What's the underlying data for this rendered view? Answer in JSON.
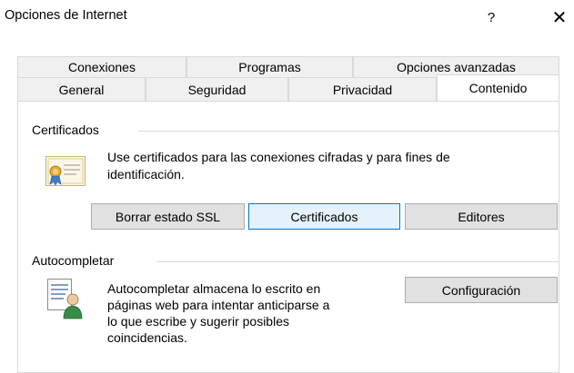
{
  "window": {
    "title": "Opciones de Internet",
    "help_glyph": "?",
    "close_glyph": "✕"
  },
  "tabs": {
    "back_row": [
      {
        "label": "Conexiones"
      },
      {
        "label": "Programas"
      },
      {
        "label": "Opciones avanzadas"
      }
    ],
    "front_row": [
      {
        "label": "General"
      },
      {
        "label": "Seguridad"
      },
      {
        "label": "Privacidad"
      },
      {
        "label": "Contenido",
        "active": true
      }
    ]
  },
  "certificates": {
    "group_label": "Certificados",
    "description_line1": "Use certificados para las conexiones cifradas y para fines de",
    "description_line2": "identificación.",
    "icon": "certificate-icon",
    "buttons": {
      "clear_ssl": "Borrar estado SSL",
      "certificates": "Certificados",
      "publishers": "Editores"
    }
  },
  "autocomplete": {
    "group_label": "Autocompletar",
    "description_lines": [
      "Autocompletar almacena lo escrito en",
      "páginas web para intentar anticiparse a",
      "lo que escribe y sugerir posibles",
      "coincidencias."
    ],
    "icon": "autocomplete-icon",
    "settings_button": "Configuración"
  },
  "colors": {
    "focus_border": "#0078d7",
    "button_face": "#e1e1e1",
    "tab_inactive": "#f0f0f0"
  }
}
